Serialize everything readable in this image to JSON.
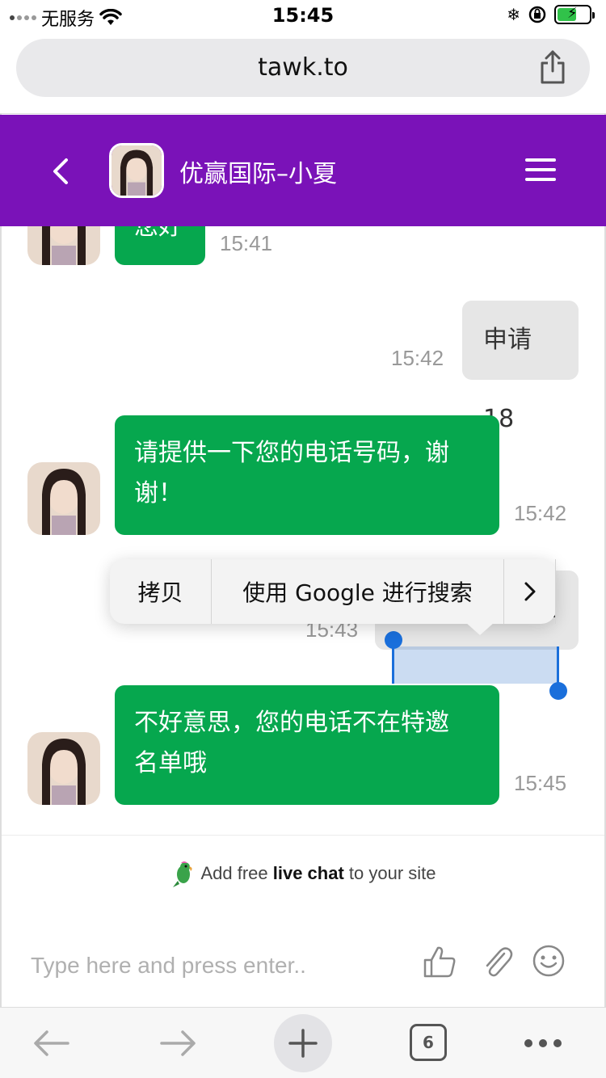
{
  "status_bar": {
    "carrier": "无服务",
    "time": "15:45"
  },
  "browser": {
    "url": "tawk.to",
    "tab_count": "6"
  },
  "chat_header": {
    "title": "优赢国际–小夏"
  },
  "messages": [
    {
      "from": "agent",
      "text": "您好",
      "time": "15:41"
    },
    {
      "from": "visitor",
      "text": "申请18",
      "time": "15:42"
    },
    {
      "from": "agent",
      "text_line1": "请提供一下您的电话号码，谢",
      "text_line2": "谢！",
      "time": "15:42"
    },
    {
      "from": "visitor",
      "text": "2",
      "time": "15:43"
    },
    {
      "from": "agent",
      "text_line1": "不好意思，您的电话不在特邀",
      "text_line2": "名单哦",
      "time": "15:45"
    }
  ],
  "context_menu": {
    "copy": "拷贝",
    "search": "使用 Google 进行搜索",
    "more": "›"
  },
  "branding": {
    "prefix": "Add free ",
    "bold": "live chat",
    "suffix": " to your site"
  },
  "composer": {
    "placeholder": "Type here and press enter.."
  },
  "colors": {
    "header": "#7a12b8",
    "agent_bubble": "#06a74e",
    "visitor_bubble": "#e6e6e6",
    "selection": "#1a6fdb"
  }
}
